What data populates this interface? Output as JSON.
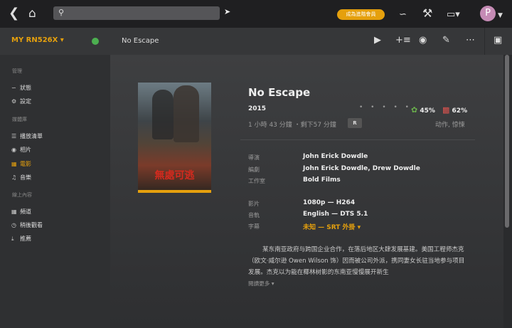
{
  "topbar": {
    "back_icon": "chevron-left-icon",
    "home_icon": "home-icon",
    "search_placeholder": "",
    "premium_label": "成為進階會員",
    "avatar_letter": "P"
  },
  "server": {
    "name": "MY RN526X ▾"
  },
  "breadcrumb": {
    "title": "No Escape"
  },
  "sidebar": {
    "sections": [
      {
        "title": "管理",
        "items": [
          {
            "icon": "activity-icon",
            "label": "狀態"
          },
          {
            "icon": "gear-icon",
            "label": "設定"
          }
        ]
      },
      {
        "title": "媒體庫",
        "items": [
          {
            "icon": "list-icon",
            "label": "播放清單"
          },
          {
            "icon": "camera-icon",
            "label": "相片"
          },
          {
            "icon": "film-icon",
            "label": "電影",
            "active": true
          },
          {
            "icon": "music-icon",
            "label": "音樂"
          }
        ]
      },
      {
        "title": "線上內容",
        "items": [
          {
            "icon": "grid-icon",
            "label": "頻道"
          },
          {
            "icon": "clock-icon",
            "label": "稍後觀看"
          },
          {
            "icon": "download-icon",
            "label": "推薦"
          }
        ]
      }
    ]
  },
  "movie": {
    "title": "No Escape",
    "year": "2015",
    "dots": "• • • • •",
    "rt_critics": "45%",
    "rt_audience": "62%",
    "duration": "1 小時 43 分鐘 ・剩下57 分鐘",
    "rating": "R",
    "genre": "动作, 惊悚",
    "poster_title": "無處可逃",
    "details": [
      {
        "label": "導演",
        "value": "John Erick Dowdle"
      },
      {
        "label": "編劇",
        "value": "John Erick Dowdle, Drew Dowdle"
      },
      {
        "label": "工作室",
        "value": "Bold Films"
      },
      {
        "label": "影片",
        "value": "1080p — H264"
      },
      {
        "label": "音軌",
        "value": "English — DTS 5.1"
      },
      {
        "label": "字幕",
        "value": "未知 — SRT 外掛 ▾"
      }
    ],
    "summary": "某东南亚政府与跨国企业合作，在落后地区大肆发展基建。美国工程师杰克（欧文·威尔逊 Owen Wilson 饰）因而被公司外派，携同妻女长驻当地参与项目发展。杰克以为能在椰林树影的东南亚慢慢展开新生",
    "read_more": "閱讀更多 ▾"
  }
}
